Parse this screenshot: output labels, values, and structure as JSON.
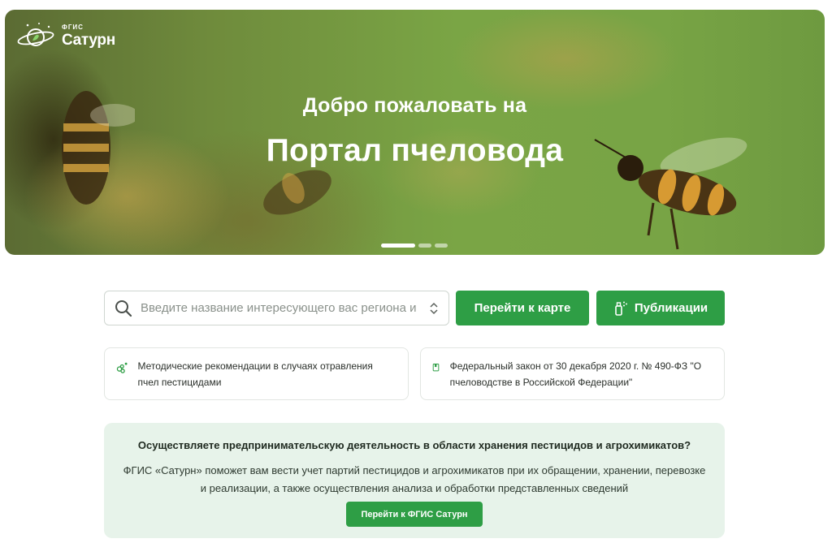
{
  "hero": {
    "logo_small": "ФГИС",
    "logo_big": "Сатурн",
    "subtitle": "Добро пожаловать на",
    "title": "Портал пчеловода"
  },
  "carousel": {
    "slides": 3,
    "active": 1
  },
  "search": {
    "placeholder": "Введите название интересующего вас региона и"
  },
  "buttons": {
    "map": "Перейти к карте",
    "publications": "Публикации"
  },
  "cards": [
    {
      "text": "Методические рекомендации в случаях отравления пчел пестицидами",
      "icon": "bee-swarm-icon"
    },
    {
      "text": "Федеральный закон от 30 декабря 2020 г. № 490-ФЗ \"О пчеловодстве в Российской Федерации\"",
      "icon": "document-icon"
    }
  ],
  "promo": {
    "title": "Осуществляете предпринимательскую деятельность в области хранения пестицидов и агрохимикатов?",
    "text": "ФГИС «Сатурн» поможет вам вести учет партий пестицидов и агрохимикатов при их обращении, хранении, перевозке и реализации, а также осуществления анализа и обработки представленных сведений",
    "button": "Перейти к ФГИС Сатурн"
  },
  "colors": {
    "accent": "#2e9e45",
    "promo_bg": "#e7f3ea"
  }
}
